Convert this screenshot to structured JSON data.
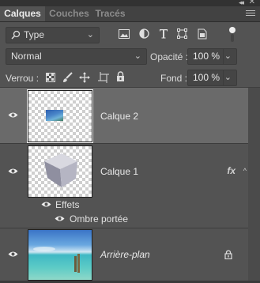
{
  "tabs": [
    "Calques",
    "Couches",
    "Tracés"
  ],
  "filter": {
    "kind_label": "Type",
    "icons": [
      "image-filter-icon",
      "adjustment-filter-icon",
      "type-filter-icon",
      "shape-filter-icon",
      "smart-object-filter-icon"
    ]
  },
  "blend": {
    "mode": "Normal",
    "opacity_label": "Opacité :",
    "opacity_value": "100 %"
  },
  "lock": {
    "label": "Verrou :",
    "icons": [
      "lock-transparency-icon",
      "lock-image-icon",
      "lock-position-icon",
      "lock-artboard-icon",
      "lock-all-icon"
    ],
    "fill_label": "Fond :",
    "fill_value": "100 %"
  },
  "layers": [
    {
      "name": "Calque 2",
      "selected": true
    },
    {
      "name": "Calque 1",
      "fx": "fx",
      "effects_label": "Effets",
      "effect_name": "Ombre portée"
    },
    {
      "name": "Arrière-plan",
      "locked": true
    }
  ],
  "colors": {
    "panel": "#535353",
    "selected_row": "#6a6a6a",
    "tab_bar": "#424242"
  }
}
